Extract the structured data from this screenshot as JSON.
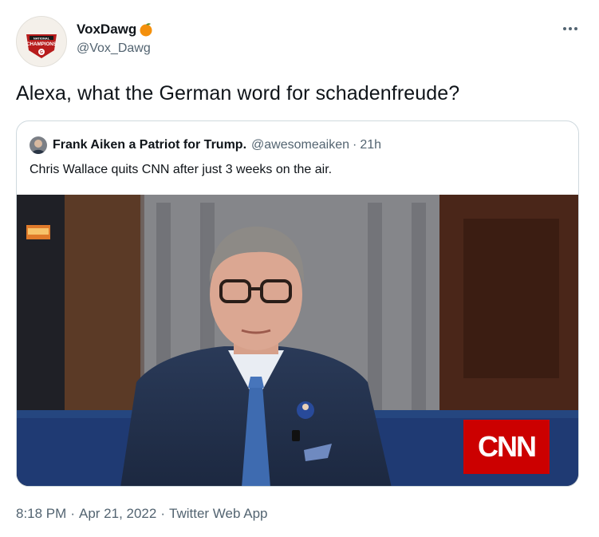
{
  "tweet": {
    "author": {
      "display_name": "VoxDawg",
      "handle": "@Vox_Dawg",
      "avatar_text": [
        "NATIONAL",
        "CHAMPIONS"
      ]
    },
    "text": "Alexa, what the German word for schadenfreude?",
    "quoted": {
      "display_name": "Frank Aiken a Patriot for Trump.",
      "handle": "@awesomeaiken",
      "separator": "·",
      "time": "21h",
      "text": "Chris Wallace quits CNN after just 3 weeks on the air.",
      "media_logo": "CNN"
    },
    "meta": {
      "time": "8:18 PM",
      "date": "Apr 21, 2022",
      "source": "Twitter Web App",
      "separator": "·"
    }
  },
  "icons": [
    "more-icon",
    "orange-emoji-icon"
  ],
  "colors": {
    "text": "#0f1419",
    "secondary": "#536471",
    "border": "#cfd9de",
    "cnn_red": "#cc0000"
  }
}
